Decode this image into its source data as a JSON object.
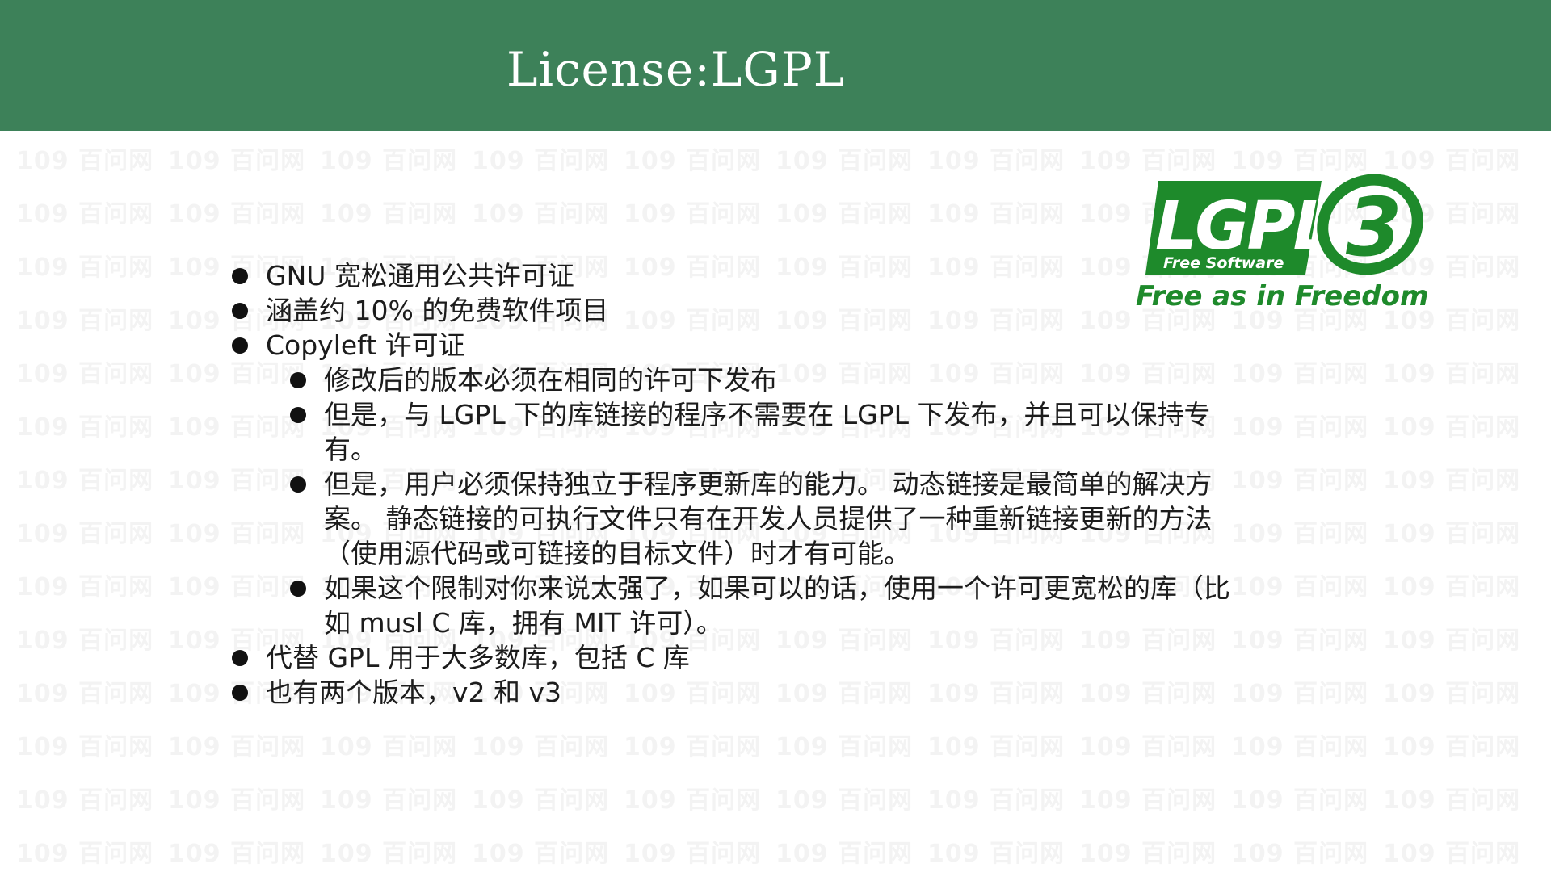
{
  "slide": {
    "title": "License:LGPL"
  },
  "bullets": [
    {
      "level": 1,
      "text": "GNU 宽松通用公共许可证"
    },
    {
      "level": 1,
      "text": "涵盖约 10% 的免费软件项目"
    },
    {
      "level": 1,
      "text": "Copyleft 许可证"
    },
    {
      "level": 2,
      "text": "修改后的版本必须在相同的许可下发布"
    },
    {
      "level": 2,
      "text": "但是，与 LGPL 下的库链接的程序不需要在 LGPL 下发布，并且可以保持专有。"
    },
    {
      "level": 2,
      "text": "但是，用户必须保持独立于程序更新库的能力。 动态链接是最简单的解决方案。 静态链接的可执行文件只有在开发人员提供了一种重新链接更新的方法（使用源代码或可链接的目标文件）时才有可能。"
    },
    {
      "level": 2,
      "text": "如果这个限制对你来说太强了，如果可以的话，使用一个许可更宽松的库（比如 musl C 库，拥有 MIT 许可）。"
    },
    {
      "level": 1,
      "text": "代替 GPL 用于大多数库，包括 C 库"
    },
    {
      "level": 1,
      "text": "也有两个版本，v2 和 v3"
    }
  ],
  "logo": {
    "badge_text": "LGPL",
    "version": "3",
    "sub_text": "Free Software",
    "tagline": "Free as in Freedom",
    "color": "#1e8a2b"
  },
  "watermark": {
    "text": "109 百问网"
  },
  "colors": {
    "title_bar": "#3d8159",
    "title_text": "#ffffff"
  }
}
